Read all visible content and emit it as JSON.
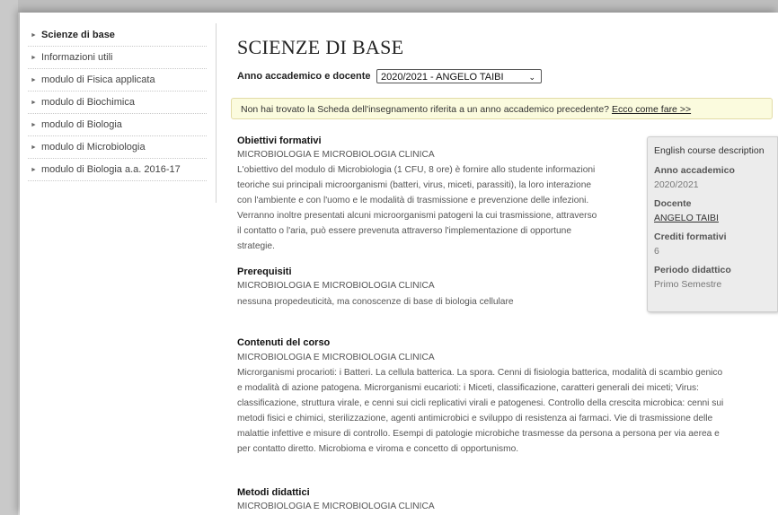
{
  "sidebar": {
    "items": [
      {
        "label": "Scienze di base",
        "active": true
      },
      {
        "label": "Informazioni utili",
        "active": false
      },
      {
        "label": "modulo di Fisica applicata",
        "active": false
      },
      {
        "label": "modulo di Biochimica",
        "active": false
      },
      {
        "label": "modulo di Biologia",
        "active": false
      },
      {
        "label": "modulo di Microbiologia",
        "active": false
      },
      {
        "label": "modulo di Biologia a.a. 2016-17",
        "active": false
      }
    ]
  },
  "main": {
    "title": "SCIENZE DI BASE",
    "year_label": "Anno accademico e docente",
    "year_selected": "2020/2021 - ANGELO TAIBI",
    "notice_text": "Non hai trovato la Scheda dell'insegnamento riferita a un anno accademico precedente?",
    "notice_link": "Ecco come fare >>",
    "sections": {
      "objectives": {
        "title": "Obiettivi formativi",
        "subtitle": "MICROBIOLOGIA E MICROBIOLOGIA CLINICA",
        "lines": [
          "L'obiettivo del modulo di Microbiologia (1 CFU, 8 ore) è fornire allo studente informazioni",
          "teoriche sui principali microorganismi (batteri, virus, miceti, parassiti), la loro interazione",
          "con l'ambiente e con l'uomo e le modalità di trasmissione e prevenzione delle infezioni.",
          "Verranno inoltre presentati alcuni microorganismi patogeni la cui trasmissione, attraverso",
          "il contatto o l'aria, può essere prevenuta attraverso l'implementazione di opportune",
          "strategie."
        ]
      },
      "prerequisites": {
        "title": "Prerequisiti",
        "subtitle": "MICROBIOLOGIA E MICROBIOLOGIA CLINICA",
        "lines": [
          "nessuna propedeuticità, ma conoscenze di base di biologia cellulare"
        ]
      },
      "contents": {
        "title": "Contenuti del corso",
        "subtitle": "MICROBIOLOGIA E MICROBIOLOGIA CLINICA",
        "lines": [
          "Microrganismi procarioti: i Batteri. La cellula batterica. La spora. Cenni di fisiologia batterica, modalità di scambio genico",
          "e modalità di azione patogena. Microrganismi eucarioti: i Miceti, classificazione, caratteri generali dei miceti; Virus:",
          "classificazione, struttura virale, e cenni sui cicli replicativi virali e patogenesi. Controllo della crescita microbica: cenni sui",
          "metodi fisici e chimici, sterilizzazione, agenti antimicrobici e sviluppo di resistenza ai farmaci. Vie di trasmissione delle",
          "malattie infettive e misure di controllo. Esempi di patologie microbiche trasmesse da persona a persona per via aerea e",
          "per contatto diretto. Microbioma e viroma e concetto di opportunismo."
        ]
      },
      "methods": {
        "title": "Metodi didattici",
        "subtitle": "MICROBIOLOGIA E MICROBIOLOGIA CLINICA"
      }
    }
  },
  "infobox": {
    "english_link": "English course description",
    "year_label": "Anno accademico",
    "year_value": "2020/2021",
    "teacher_label": "Docente",
    "teacher_value": "ANGELO TAIBI",
    "credits_label": "Crediti formativi",
    "credits_value": "6",
    "period_label": "Periodo didattico",
    "period_value": "Primo Semestre"
  }
}
